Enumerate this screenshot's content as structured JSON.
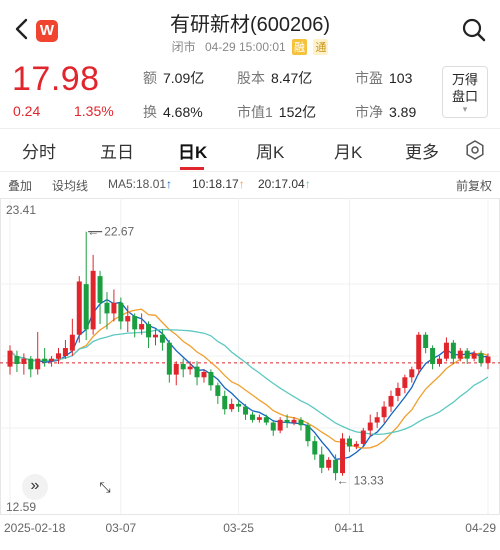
{
  "header": {
    "title": "有研新材(600206)",
    "market": "闭市",
    "datetime": "04-29 15:00:01",
    "tag1": "融",
    "tag2": "通",
    "logo": "W"
  },
  "quote": {
    "price": "17.98",
    "change": "0.24",
    "change_pct": "1.35%",
    "stats": [
      {
        "label": "额",
        "value": "7.09亿"
      },
      {
        "label": "股本",
        "value": "8.47亿"
      },
      {
        "label": "市盈",
        "value": "103"
      },
      {
        "label": "换",
        "value": "4.68%"
      },
      {
        "label": "市值1",
        "value": "152亿"
      },
      {
        "label": "市净",
        "value": "3.89"
      }
    ],
    "wande_line1": "万得",
    "wande_line2": "盘口"
  },
  "tabs": [
    "分时",
    "五日",
    "日K",
    "周K",
    "月K",
    "更多"
  ],
  "active_tab": "日K",
  "indicators": {
    "stack": "叠加",
    "trend": "设均线",
    "ma5": "MA5:18.01",
    "ma10": "10:18.17",
    "ma20": "20:17.04",
    "adjust": "前复权"
  },
  "colors": {
    "up": "#e0262c",
    "down": "#1a9e3f",
    "ma5": "#1565c0",
    "ma10": "#f0a030",
    "ma20": "#5cc8c0",
    "accent": "#e0262c"
  },
  "chart_data": {
    "type": "candlestick",
    "y_max_label": "23.41",
    "y_min_label": "12.59",
    "ylim": [
      12.59,
      23.41
    ],
    "high_annotation": "22.67",
    "low_annotation": "13.33",
    "x_labels": [
      "2025-02-18",
      "03-07",
      "03-25",
      "04-11",
      "04-29"
    ],
    "reference_price": 17.74,
    "candles": [
      [
        17.6,
        18.2,
        17.3,
        18.4
      ],
      [
        18.0,
        17.7,
        17.4,
        18.2
      ],
      [
        17.7,
        17.9,
        17.3,
        18.1
      ],
      [
        17.9,
        17.5,
        17.2,
        18.0
      ],
      [
        17.5,
        17.9,
        17.3,
        18.9
      ],
      [
        17.9,
        17.8,
        17.6,
        18.3
      ],
      [
        17.8,
        17.9,
        17.6,
        18.0
      ],
      [
        17.9,
        18.1,
        17.7,
        18.3
      ],
      [
        18.0,
        18.3,
        17.9,
        18.6
      ],
      [
        18.2,
        18.8,
        18.0,
        19.4
      ],
      [
        18.8,
        20.8,
        18.5,
        21.0
      ],
      [
        20.7,
        19.0,
        18.6,
        22.67
      ],
      [
        19.0,
        21.2,
        18.8,
        21.8
      ],
      [
        21.0,
        20.0,
        19.2,
        21.2
      ],
      [
        20.0,
        19.6,
        19.0,
        20.4
      ],
      [
        19.6,
        20.0,
        19.3,
        20.5
      ],
      [
        20.0,
        19.3,
        19.0,
        20.2
      ],
      [
        19.3,
        19.5,
        18.9,
        19.9
      ],
      [
        19.5,
        19.0,
        18.7,
        19.6
      ],
      [
        19.0,
        19.2,
        18.8,
        19.6
      ],
      [
        19.2,
        18.7,
        18.3,
        19.3
      ],
      [
        18.7,
        18.8,
        18.4,
        19.0
      ],
      [
        18.8,
        18.5,
        18.2,
        19.0
      ],
      [
        18.5,
        17.3,
        17.0,
        18.6
      ],
      [
        17.3,
        17.7,
        16.9,
        17.8
      ],
      [
        17.7,
        17.5,
        17.2,
        17.9
      ],
      [
        17.5,
        17.6,
        17.3,
        17.8
      ],
      [
        17.6,
        17.2,
        16.9,
        17.8
      ],
      [
        17.2,
        17.4,
        17.0,
        17.5
      ],
      [
        17.4,
        16.9,
        16.7,
        17.5
      ],
      [
        16.9,
        16.5,
        16.2,
        17.0
      ],
      [
        16.5,
        16.0,
        15.8,
        16.7
      ],
      [
        16.0,
        16.2,
        15.9,
        16.4
      ],
      [
        16.2,
        16.1,
        15.9,
        16.3
      ],
      [
        16.1,
        15.8,
        15.6,
        16.2
      ],
      [
        15.8,
        15.6,
        15.5,
        15.9
      ],
      [
        15.6,
        15.7,
        15.5,
        15.8
      ],
      [
        15.7,
        15.5,
        15.4,
        15.8
      ],
      [
        15.5,
        15.2,
        15.0,
        15.6
      ],
      [
        15.2,
        15.6,
        15.1,
        15.7
      ],
      [
        15.6,
        15.5,
        15.3,
        15.8
      ],
      [
        15.5,
        15.6,
        15.4,
        15.7
      ],
      [
        15.6,
        15.4,
        15.2,
        15.7
      ],
      [
        15.4,
        14.8,
        14.6,
        15.5
      ],
      [
        14.8,
        14.3,
        14.1,
        15.0
      ],
      [
        14.3,
        13.8,
        13.6,
        14.6
      ],
      [
        13.8,
        14.1,
        13.7,
        14.2
      ],
      [
        14.1,
        13.6,
        13.33,
        14.3
      ],
      [
        13.6,
        14.9,
        13.5,
        15.1
      ],
      [
        14.9,
        14.6,
        14.4,
        15.0
      ],
      [
        14.6,
        14.7,
        14.5,
        14.8
      ],
      [
        14.7,
        15.2,
        14.6,
        15.3
      ],
      [
        15.2,
        15.5,
        15.0,
        15.8
      ],
      [
        15.5,
        15.7,
        15.3,
        15.9
      ],
      [
        15.7,
        16.1,
        15.5,
        16.3
      ],
      [
        16.1,
        16.5,
        15.9,
        16.7
      ],
      [
        16.5,
        16.8,
        16.3,
        17.0
      ],
      [
        16.8,
        17.2,
        16.6,
        17.3
      ],
      [
        17.2,
        17.5,
        17.0,
        17.6
      ],
      [
        17.5,
        18.8,
        17.3,
        18.9
      ],
      [
        18.8,
        18.3,
        18.1,
        18.9
      ],
      [
        18.3,
        17.7,
        17.5,
        18.4
      ],
      [
        17.7,
        17.9,
        17.6,
        18.0
      ],
      [
        17.9,
        18.5,
        17.8,
        18.7
      ],
      [
        18.5,
        17.9,
        17.7,
        18.6
      ],
      [
        17.9,
        18.2,
        17.8,
        18.3
      ],
      [
        18.2,
        17.9,
        17.7,
        18.3
      ],
      [
        17.9,
        18.1,
        17.8,
        18.2
      ],
      [
        18.1,
        17.74,
        17.6,
        18.2
      ],
      [
        17.74,
        17.98,
        17.5,
        18.1
      ]
    ]
  },
  "icons": {
    "back": "back-arrow-icon",
    "search": "search-icon",
    "settings": "settings-icon",
    "expand": "expand-icon",
    "zoom": "fullscreen-icon"
  }
}
